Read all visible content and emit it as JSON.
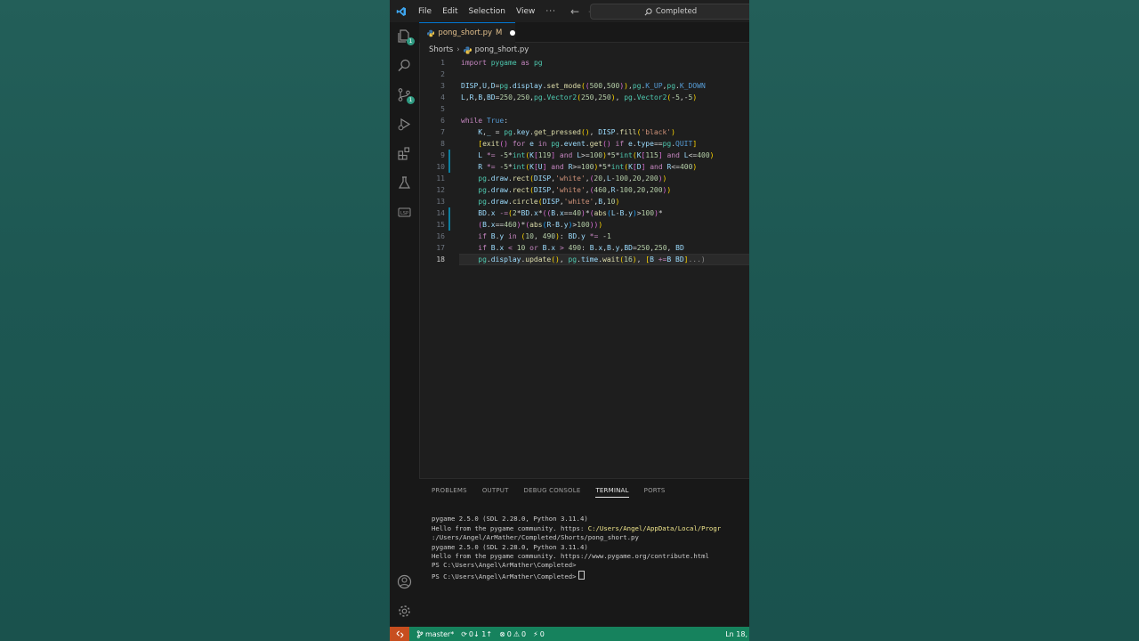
{
  "menu": {
    "file": "File",
    "edit": "Edit",
    "selection": "Selection",
    "view": "View",
    "more": "···"
  },
  "command_center": {
    "label": "Completed"
  },
  "tab": {
    "filename": "pong_short.py",
    "modified": "M"
  },
  "breadcrumb": {
    "folder": "Shorts",
    "file": "pong_short.py"
  },
  "activity_badges": {
    "explorer": "1",
    "scm": "1"
  },
  "editor": {
    "line_numbers": [
      "1",
      "2",
      "3",
      "4",
      "5",
      "6",
      "7",
      "8",
      "9",
      "10",
      "11",
      "12",
      "13",
      "14",
      "15",
      "16",
      "17",
      "18"
    ],
    "active_line": "18"
  },
  "panel": {
    "tabs": [
      "PROBLEMS",
      "OUTPUT",
      "DEBUG CONSOLE",
      "TERMINAL",
      "PORTS"
    ],
    "active_tab": "TERMINAL",
    "terminal_lines": [
      "pygame 2.5.0 (SDL 2.28.0, Python 3.11.4)",
      "Hello from the pygame community. https:",
      ":/Users/Angel/ArMather/Completed/Shorts/pong_short.py",
      "pygame 2.5.0 (SDL 2.28.0, Python 3.11.4)",
      "Hello from the pygame community. https://www.pygame.org/contribute.html",
      "PS C:\\Users\\Angel\\ArMather\\Completed>",
      "PS C:\\Users\\Angel\\ArMather\\Completed>"
    ],
    "terminal_link": "C:/Users/Angel/AppData/Local/Progr"
  },
  "status": {
    "branch": "master*",
    "sync": "0↓ 1↑",
    "errors": "0",
    "warnings": "0",
    "ports": "0",
    "position": "Ln 18,"
  },
  "colors": {
    "accent": "#0078d4",
    "statusbar": "#16825d",
    "remote": "#c74e1f",
    "background": "#1f5d57"
  }
}
